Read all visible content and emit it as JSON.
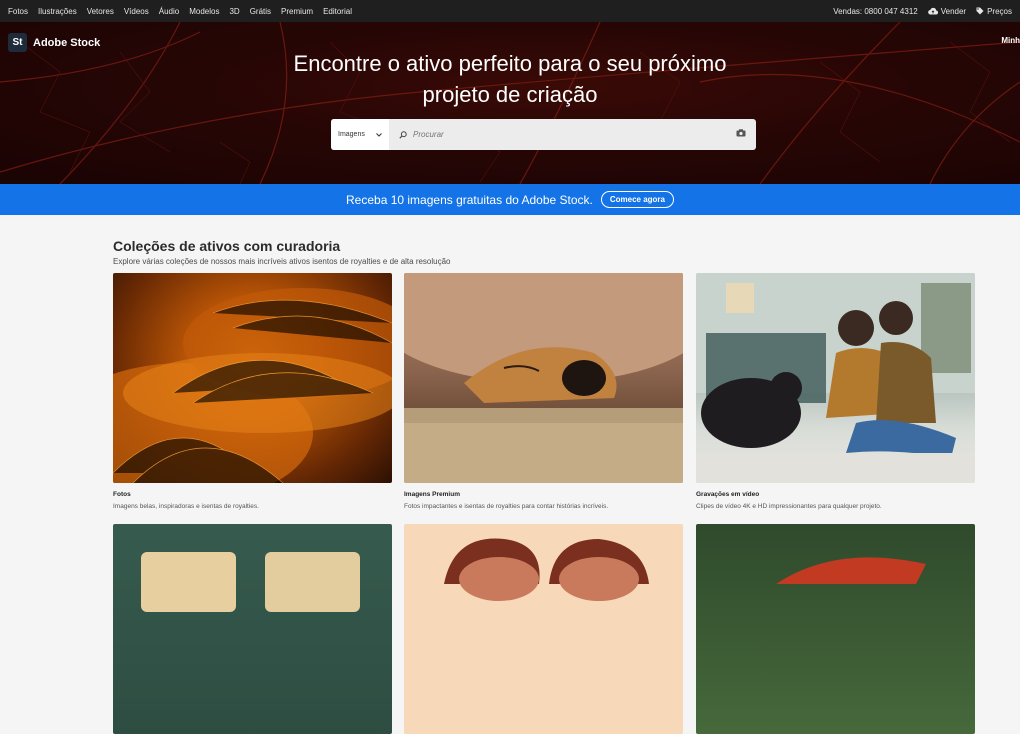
{
  "topnav": {
    "links": [
      "Fotos",
      "Ilustrações",
      "Vetores",
      "Vídeos",
      "Áudio",
      "Modelos",
      "3D",
      "Grátis",
      "Premium",
      "Editorial"
    ],
    "sales": "Vendas: 0800 047 4312",
    "sell": "Vender",
    "pricing": "Preços"
  },
  "brand": {
    "badge": "St",
    "name": "Adobe Stock"
  },
  "hero": {
    "title_line1": "Encontre o ativo perfeito para o seu próximo",
    "title_line2": "projeto de criação",
    "corner_text": "Minh"
  },
  "search": {
    "type_value": "Imagens",
    "placeholder": "Procurar"
  },
  "promo": {
    "text": "Receba 10 imagens gratuitas do Adobe Stock.",
    "cta": "Comece agora"
  },
  "collections": {
    "title": "Coleções de ativos com curadoria",
    "subtitle": "Explore várias coleções de nossos mais incríveis ativos isentos de royalties e de alta resolução",
    "cards": [
      {
        "title": "Fotos",
        "desc": "Imagens belas, inspiradoras e isentas de royalties."
      },
      {
        "title": "Imagens Premium",
        "desc": "Fotos impactantes e isentas de royalties para contar histórias incríveis."
      },
      {
        "title": "Gravações em vídeo",
        "desc": "Clipes de vídeo 4K e HD impressionantes para qualquer projeto."
      }
    ]
  },
  "colors": {
    "promo": "#1473e6",
    "topnav": "#1f1f1f",
    "hero": "#260605"
  }
}
